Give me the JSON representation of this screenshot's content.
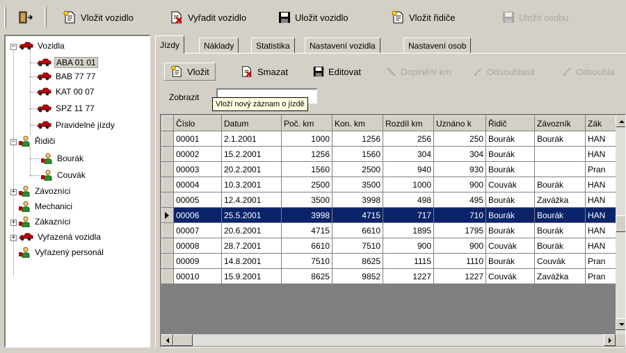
{
  "toolbar": {
    "insert_vehicle": "Vložit vozidlo",
    "retire_vehicle": "Vyřadit vozidlo",
    "save_vehicle": "Uložit vozidlo",
    "insert_driver": "Vložit řidiče",
    "save_person": "Uložit osobu"
  },
  "tree": {
    "vehicles": "Vozidla",
    "vehicle_items": [
      "ABA 01 01",
      "BAB 77 77",
      "KAT 00 07",
      "SPZ 11 77",
      "Pravidelné jízdy"
    ],
    "drivers": "Řidiči",
    "driver_items": [
      "Bourák",
      "Couvák"
    ],
    "couriers": "Závozníci",
    "mechanics": "Mechanici",
    "customers": "Zákazníci",
    "retired_vehicles": "Vyřazená vozidla",
    "retired_personnel": "Vyřazený personál"
  },
  "tabs": [
    "Jízdy",
    "Náklady",
    "Statistika",
    "Nastavení vozidla",
    "Nastavení osob"
  ],
  "subtoolbar": {
    "insert": "Vložit",
    "delete": "Smazat",
    "edit": "Editovat",
    "fill_km": "Doplnění km",
    "approve": "Odsouhlasit",
    "approve2": "Odsouhla"
  },
  "filter": {
    "label": "Zobrazit",
    "tooltip": "Vloží nový záznam o jízdě"
  },
  "grid": {
    "columns": [
      "Číslo",
      "Datum",
      "Poč. km",
      "Kon. km",
      "Rozdíl km",
      "Uznáno k",
      "Řidič",
      "Závozník",
      "Zák"
    ],
    "rows": [
      [
        "00001",
        "2.1.2001",
        "1000",
        "1256",
        "256",
        "250",
        "Bourák",
        "Bourák",
        "HAN"
      ],
      [
        "00002",
        "15.2.2001",
        "1256",
        "1560",
        "304",
        "304",
        "Bourák",
        "",
        "HAN"
      ],
      [
        "00003",
        "20.2.2001",
        "1560",
        "2500",
        "940",
        "930",
        "Bourák",
        "",
        "Pran"
      ],
      [
        "00004",
        "10.3.2001",
        "2500",
        "3500",
        "1000",
        "900",
        "Couvák",
        "Bourák",
        "HAN"
      ],
      [
        "00005",
        "12.4.2001",
        "3500",
        "3998",
        "498",
        "495",
        "Bourák",
        "Zavážka",
        "HAN"
      ],
      [
        "00006",
        "25.5.2001",
        "3998",
        "4715",
        "717",
        "710",
        "Bourák",
        "Bourák",
        "HAN"
      ],
      [
        "00007",
        "20.6.2001",
        "4715",
        "6610",
        "1895",
        "1795",
        "Bourák",
        "Bourák",
        "HAN"
      ],
      [
        "00008",
        "28.7.2001",
        "6610",
        "7510",
        "900",
        "900",
        "Couvák",
        "Bourák",
        "HAN"
      ],
      [
        "00009",
        "14.8.2001",
        "7510",
        "8625",
        "1115",
        "1110",
        "Bourák",
        "Couvák",
        "Pran"
      ],
      [
        "00010",
        "15.9.2001",
        "8625",
        "9852",
        "1227",
        "1227",
        "Couvák",
        "Zavážka",
        "Pran"
      ]
    ],
    "selected_row": 5
  },
  "colors": {
    "face": "#d4d0c8",
    "selection": "#0a246a",
    "vehicle_icon": "#c00000",
    "person_icon": "#2e8b2e"
  }
}
